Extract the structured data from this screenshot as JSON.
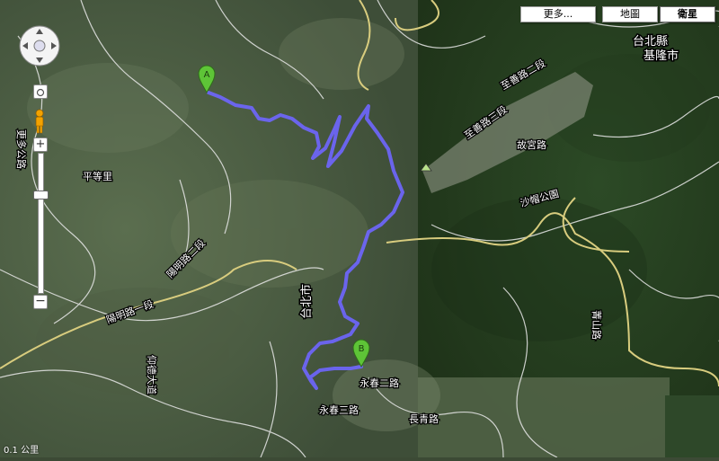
{
  "map_type_buttons": {
    "more": "更多...",
    "map": "地圖",
    "satellite": "衛星"
  },
  "markers": {
    "start": "A",
    "end": "B"
  },
  "region_labels": {
    "taipei_county": "台北縣",
    "keelung_city": "基隆市",
    "taipei_city": "台北市"
  },
  "road_labels": [
    "更多公路",
    "平等里",
    "至善路三段",
    "故宮路",
    "至善路二段",
    "永春三路",
    "永春二路",
    "長青路",
    "沙帽公園",
    "陽明路一段",
    "陽明路二段",
    "菁山路",
    "仰德大道"
  ],
  "scale_text": "0.1 公里",
  "colors": {
    "route": "#6f66ff",
    "marker_green": "#5ec437",
    "road_yellow": "#d8cc7e"
  },
  "icons": {
    "pan": "pan-control-icon",
    "pegman": "pegman-icon",
    "zoom_in": "zoom-in-icon",
    "zoom_out": "zoom-out-icon"
  }
}
